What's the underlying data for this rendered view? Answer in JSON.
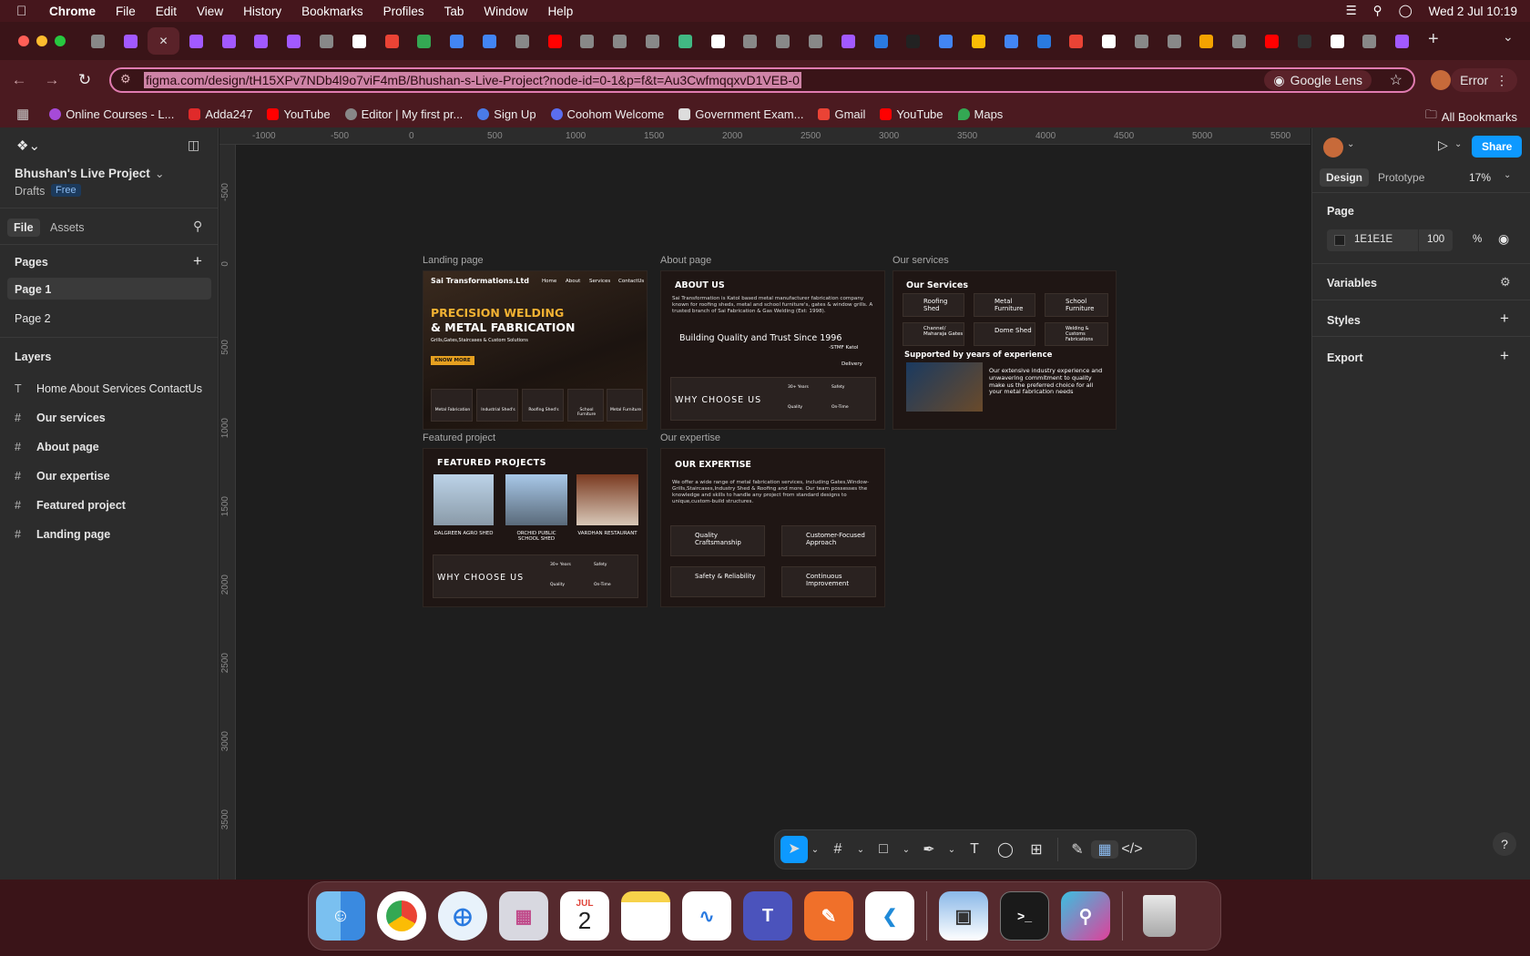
{
  "menubar": {
    "app": "Chrome",
    "items": [
      "File",
      "Edit",
      "View",
      "History",
      "Bookmarks",
      "Profiles",
      "Tab",
      "Window",
      "Help"
    ],
    "datetime": "Wed 2 Jul  10:19"
  },
  "browser": {
    "url": "figma.com/design/tH15XPv7NDb4l9o7viF4mB/Bhushan-s-Live-Project?node-id=0-1&p=f&t=Au3CwfmqqxvD1VEB-0",
    "lens_label": "Google Lens",
    "error_label": "Error"
  },
  "bookmarks": [
    "Online Courses - L...",
    "Adda247",
    "YouTube",
    "Editor | My first pr...",
    "Sign Up",
    "Coohom Welcome",
    "Government Exam...",
    "Gmail",
    "YouTube",
    "Maps"
  ],
  "all_bookmarks": "All Bookmarks",
  "figma": {
    "project": "Bhushan's Live Project",
    "drafts": "Drafts",
    "plan": "Free",
    "tabs": {
      "file": "File",
      "assets": "Assets"
    },
    "pages_label": "Pages",
    "pages": [
      "Page 1",
      "Page 2"
    ],
    "layers_label": "Layers",
    "layers": [
      "Home About Services ContactUs",
      "Our services",
      "About page",
      "Our expertise",
      "Featured project",
      "Landing page"
    ],
    "right": {
      "design": "Design",
      "prototype": "Prototype",
      "zoom": "17%",
      "share": "Share",
      "page_label": "Page",
      "page_color": "1E1E1E",
      "opacity": "100",
      "pct": "%",
      "variables": "Variables",
      "styles": "Styles",
      "export": "Export"
    },
    "ruler_x": [
      "-1000",
      "-500",
      "0",
      "500",
      "1000",
      "1500",
      "2000",
      "2500",
      "3000",
      "3500",
      "4000",
      "4500",
      "5000",
      "5500"
    ],
    "ruler_y": [
      "-500",
      "0",
      "500",
      "1000",
      "1500",
      "2000",
      "2500",
      "3000",
      "3500"
    ],
    "frames": {
      "landing": {
        "label": "Landing page",
        "logo": "Sai Transformations.Ltd",
        "nav": [
          "Home",
          "About",
          "Services",
          "ContactUs"
        ],
        "h1": "PRECISION WELDING",
        "h2": "& METAL FABRICATION",
        "sub": "Grills,Gates,Staircases & Custom Solutions",
        "cta": "KNOW MORE",
        "cats": [
          "Metal Fabrication",
          "Industrial Shed's",
          "Roofing Shed's",
          "School Furniture",
          "Metal Furniture"
        ]
      },
      "about": {
        "label": "About page",
        "title": "ABOUT US",
        "body": "Sai Transformation is Katol based metal manufacturer fabrication company known for roofing sheds, metal and school furniture's, gates & window grills. A trusted branch of Sai Fabrication & Gas Welding (Est: 1998).",
        "quote": "Building Quality and Trust Since 1996",
        "attr": "-STMF Katol",
        "delivery": "Delivery",
        "why": "WHY CHOOSE US",
        "feats": [
          "30+ Years",
          "Safety",
          "Quality",
          "On-Time"
        ]
      },
      "services": {
        "label": "Our services",
        "title": "Our Services",
        "items": [
          "Roofing Shed",
          "Metal Furniture",
          "School Furniture",
          "Channel/ Maharaja Gates",
          "Dome Shed",
          "Welding & Customs Fabrications"
        ],
        "support": "Supported by years of experience",
        "support_body": "Our extensive industry experience and unwavering commitment to quality make us the preferred choice for all your metal fabrication needs"
      },
      "featured": {
        "label": "Featured project",
        "title": "FEATURED PROJECTS",
        "projects": [
          "DALGREEN AGRO SHED",
          "ORCHID PUBLIC SCHOOL SHED",
          "VARDHAN RESTAURANT"
        ],
        "why": "WHY CHOOSE US",
        "feats": [
          "30+ Years",
          "Safety",
          "Quality",
          "On-Time"
        ]
      },
      "expertise": {
        "label": "Our expertise",
        "title": "OUR EXPERTISE",
        "body": "We offer a wide range of metal fabrication services, including Gates,Window-Grills,Staircases,Industry Shed & Roofing and more. Our team possesses the knowledge and skills to handle any project from standard designs to unique,custom-build structures.",
        "cards": [
          "Quality Craftsmanship",
          "Customer-Focused Approach",
          "Safety & Reliability",
          "Continuous Improvement"
        ]
      }
    }
  },
  "dock": [
    "Finder",
    "Chrome",
    "Safari",
    "Launchpad",
    "Calendar",
    "Notes",
    "Freeform",
    "Teams",
    "Pages",
    "VS Code",
    "Preview",
    "Terminal",
    "Instruments",
    "Trash"
  ],
  "calendar": {
    "month": "JUL",
    "day": "2"
  }
}
